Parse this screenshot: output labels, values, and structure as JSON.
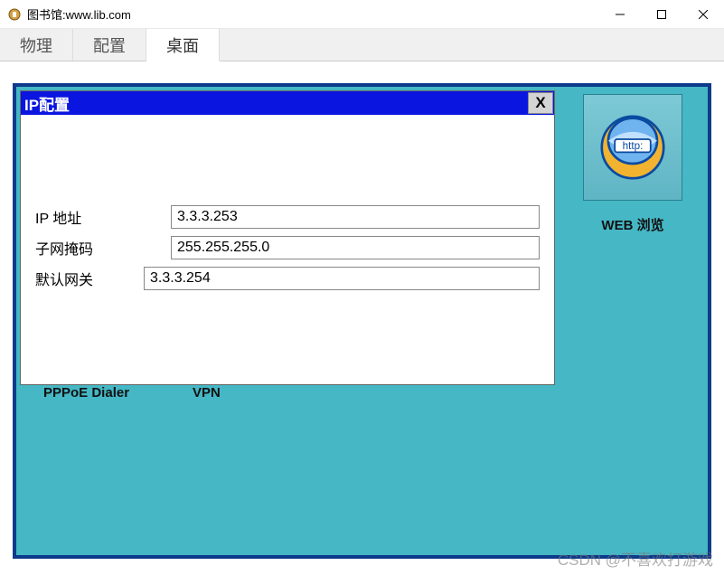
{
  "titlebar": {
    "title": "图书馆:www.lib.com"
  },
  "tabs": {
    "items": [
      {
        "label": "物理"
      },
      {
        "label": "配置"
      },
      {
        "label": "桌面"
      }
    ],
    "active_index": 2
  },
  "desktop": {
    "icons": [
      {
        "label": "WEB 浏览",
        "name": "web-browser-icon",
        "http_text": "http:"
      }
    ],
    "background_labels": [
      {
        "label": "PPPoE Dialer"
      },
      {
        "label": "VPN"
      }
    ]
  },
  "ipconfig": {
    "title": "IP配置",
    "close": "X",
    "fields": {
      "ip_address": {
        "label": "IP 地址",
        "value": "3.3.3.253"
      },
      "subnet_mask": {
        "label": "子网掩码",
        "value": "255.255.255.0"
      },
      "default_gateway": {
        "label": "默认网关",
        "value": "3.3.3.254"
      }
    }
  },
  "watermark": "CSDN @不喜欢打游戏"
}
